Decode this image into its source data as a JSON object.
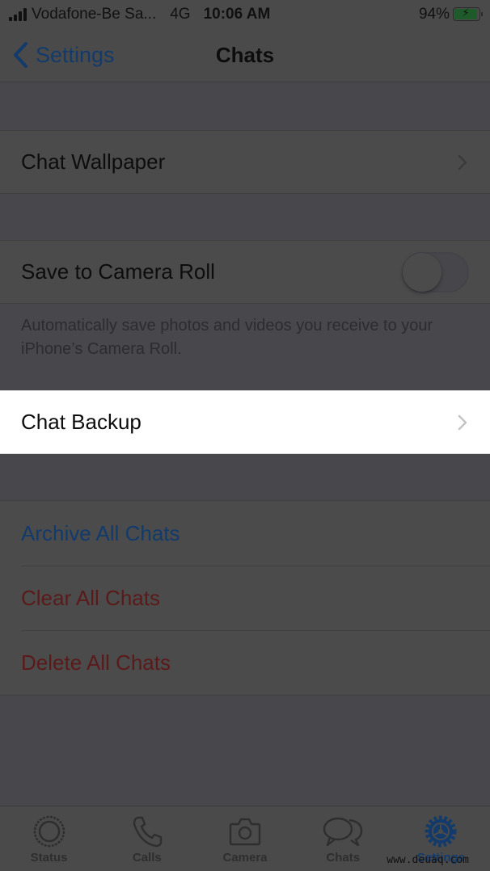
{
  "status_bar": {
    "carrier": "Vodafone-Be Sa...",
    "network": "4G",
    "time": "10:06 AM",
    "battery_percent": "94%",
    "battery_level": 0.94,
    "charging": true,
    "signal_bars": 4
  },
  "nav": {
    "back_label": "Settings",
    "title": "Chats"
  },
  "sections": {
    "wallpaper": {
      "label": "Chat Wallpaper"
    },
    "camera_roll": {
      "label": "Save to Camera Roll",
      "toggle_on": false,
      "footnote": "Automatically save photos and videos you receive to your iPhone’s Camera Roll."
    },
    "backup": {
      "label": "Chat Backup",
      "highlighted": true
    },
    "actions": [
      {
        "label": "Archive All Chats",
        "color": "#123a6b"
      },
      {
        "label": "Clear All Chats",
        "color": "#5a1a1a"
      },
      {
        "label": "Delete All Chats",
        "color": "#5a1a1a"
      }
    ]
  },
  "tab_bar": {
    "tabs": [
      {
        "label": "Status",
        "icon": "status-icon",
        "active": false
      },
      {
        "label": "Calls",
        "icon": "phone-icon",
        "active": false
      },
      {
        "label": "Camera",
        "icon": "camera-icon",
        "active": false
      },
      {
        "label": "Chats",
        "icon": "chat-bubbles-icon",
        "active": false
      },
      {
        "label": "Settings",
        "icon": "gear-icon",
        "active": true
      }
    ]
  },
  "colors": {
    "accent_blue": "#123a6b",
    "destructive_red": "#5a1a1a",
    "overlay_background": "#48474c",
    "highlight_cell": "#ffffff"
  },
  "watermark": "www.deuaq.com"
}
